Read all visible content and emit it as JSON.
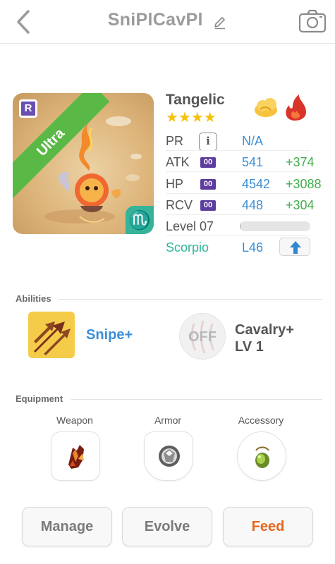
{
  "header": {
    "title": "SniPlCavPl"
  },
  "monster": {
    "name": "Tangelic",
    "stars": "★★★★",
    "rarity_badge": "R",
    "rarity_ribbon": "Ultra",
    "sign_glyph": "♏",
    "element_icons": [
      "cloud-icon",
      "fire-icon"
    ]
  },
  "stats": {
    "pr": {
      "label": "PR",
      "info": "i",
      "value": "N/A"
    },
    "atk": {
      "label": "ATK",
      "boost": "00",
      "value": "541",
      "plus": "+374"
    },
    "hp": {
      "label": "HP",
      "boost": "00",
      "value": "4542",
      "plus": "+3088"
    },
    "rcv": {
      "label": "RCV",
      "boost": "00",
      "value": "448",
      "plus": "+304"
    },
    "level": {
      "label": "Level 07",
      "progress": 0.02
    },
    "sign": {
      "label": "Scorpio",
      "level": "L46"
    }
  },
  "abilities": {
    "title": "Abilities",
    "ability1": {
      "name": "Snipe+"
    },
    "ability2": {
      "state": "OFF",
      "name_line1": "Cavalry+",
      "name_line2": "LV 1"
    }
  },
  "equipment": {
    "title": "Equipment",
    "weapon_label": "Weapon",
    "armor_label": "Armor",
    "accessory_label": "Accessory"
  },
  "actions": {
    "manage": "Manage",
    "evolve": "Evolve",
    "feed": "Feed"
  },
  "colors": {
    "accent_blue": "#3b8fd6",
    "plus_green": "#3fae4a",
    "scorpio_teal": "#2fb59b",
    "feed_orange": "#e7661f",
    "ultra_green": "#5ab946"
  }
}
